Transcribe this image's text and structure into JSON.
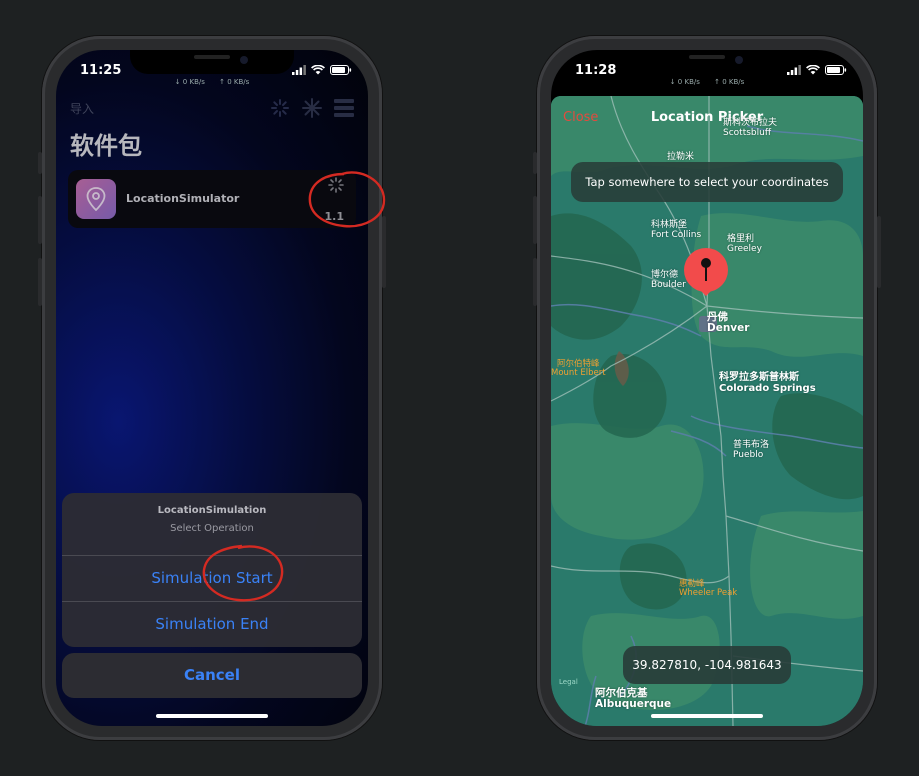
{
  "left_phone": {
    "status": {
      "time": "11:25",
      "net_down": "↓ 0 KB/s",
      "net_up": "↑ 0 KB/s"
    },
    "nav": {
      "import_label": "导入"
    },
    "title": "软件包",
    "package": {
      "name": "LocationSimulator",
      "version": "1.1"
    },
    "action_sheet": {
      "title": "LocationSimulation",
      "subtitle": "Select Operation",
      "buttons": [
        "Simulation Start",
        "Simulation End"
      ],
      "cancel": "Cancel"
    },
    "accent_color": "#3a82f7"
  },
  "right_phone": {
    "status": {
      "time": "11:28",
      "net_down": "↓ 0 KB/s",
      "net_up": "↑ 0 KB/s"
    },
    "header": {
      "close": "Close",
      "title": "Location Picker"
    },
    "hint": "Tap somewhere to select your coordinates",
    "coordinates": "39.827810, -104.981643",
    "legal": "Legal",
    "cities": [
      {
        "zh": "斯科茨布拉夫",
        "en": "Scottsbluff"
      },
      {
        "zh": "拉勒米",
        "en": ""
      },
      {
        "zh": "科林斯堡",
        "en": "Fort Collins"
      },
      {
        "zh": "格里利",
        "en": "Greeley"
      },
      {
        "zh": "博尔德",
        "en": "Boulder"
      },
      {
        "zh": "丹佛",
        "en": "Denver"
      },
      {
        "zh": "科罗拉多斯普林斯",
        "en": "Colorado Springs"
      },
      {
        "zh": "普韦布洛",
        "en": "Pueblo"
      },
      {
        "zh": "阿尔伯克基",
        "en": "Albuquerque"
      }
    ],
    "peaks": [
      {
        "zh": "阿尔伯特峰",
        "en": "Mount Elbert"
      },
      {
        "zh": "惠勒峰",
        "en": "Wheeler Peak"
      }
    ],
    "close_color": "#e54a3e",
    "pin_color": "#f24b4b",
    "map_color": "#2a7a6b"
  }
}
